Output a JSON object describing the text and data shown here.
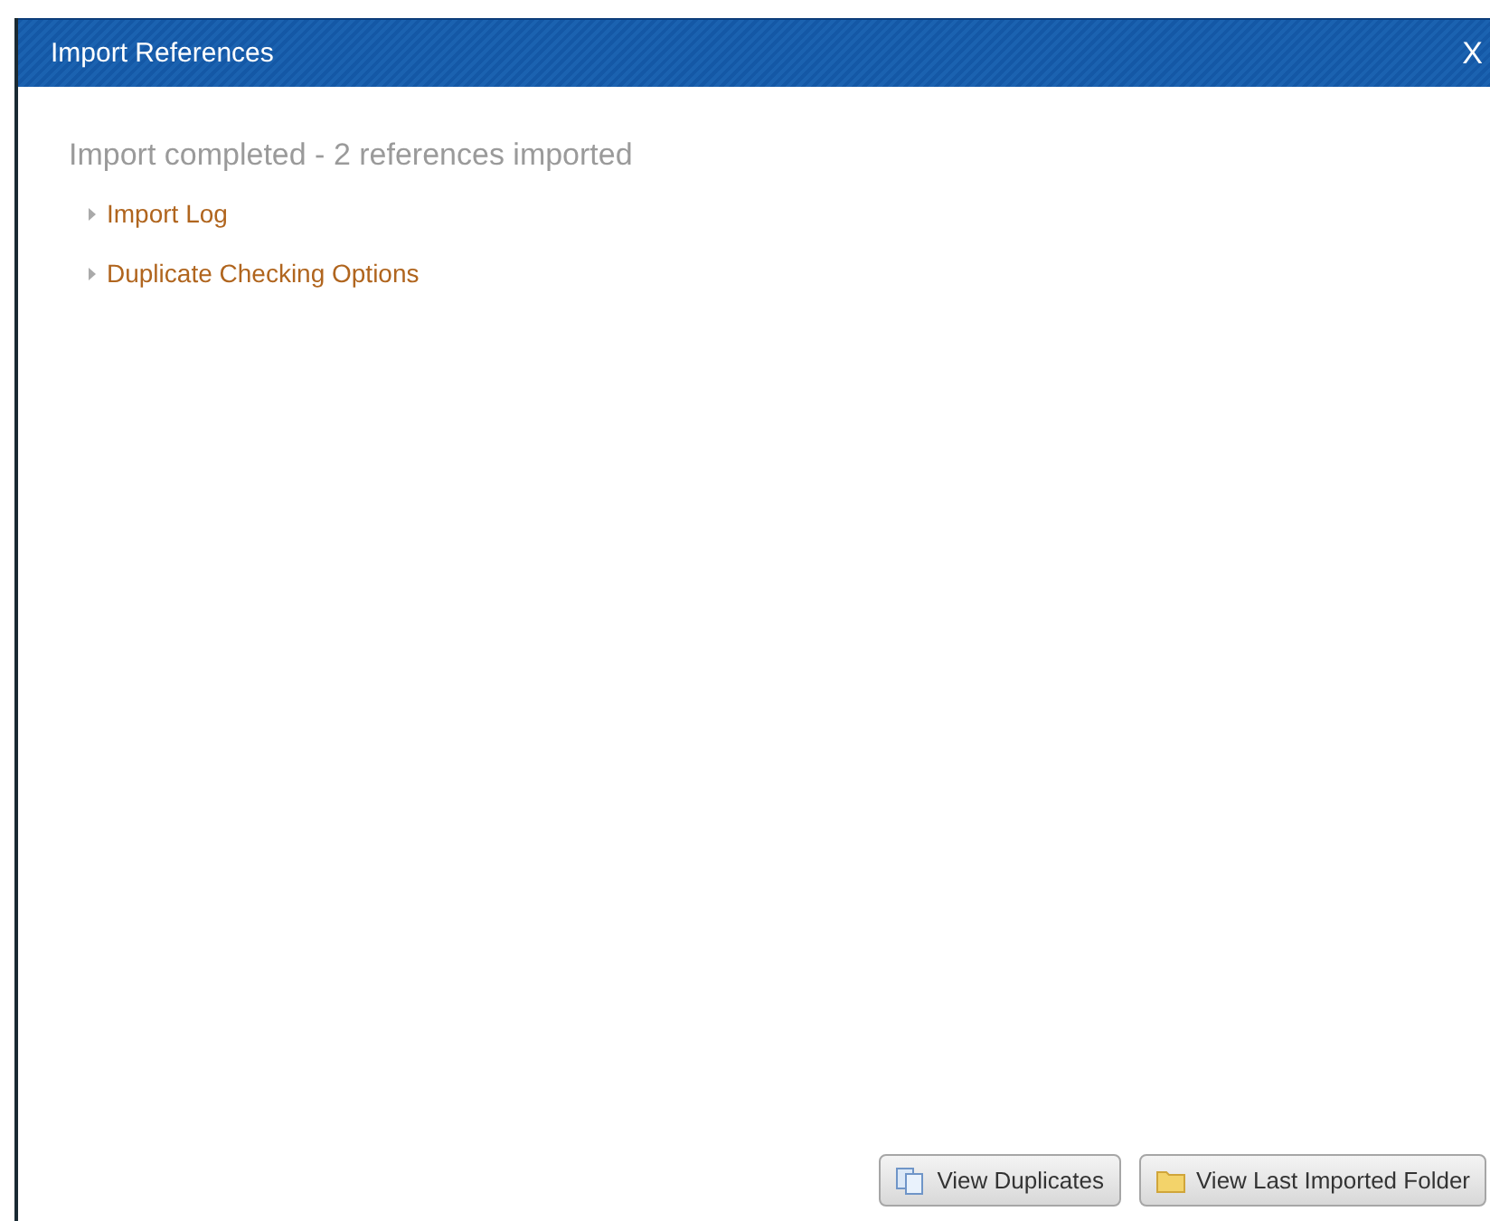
{
  "window": {
    "title": "Import References",
    "close": "X"
  },
  "heading": "Import completed - 2 references imported",
  "sections": [
    {
      "label": "Import Log",
      "expanded": false
    },
    {
      "label": "Duplicate Checking Options",
      "expanded": false
    }
  ],
  "buttons": [
    {
      "kind": "duplicates",
      "label": "View Duplicates"
    },
    {
      "kind": "folder",
      "label": "View Last Imported Folder"
    }
  ]
}
